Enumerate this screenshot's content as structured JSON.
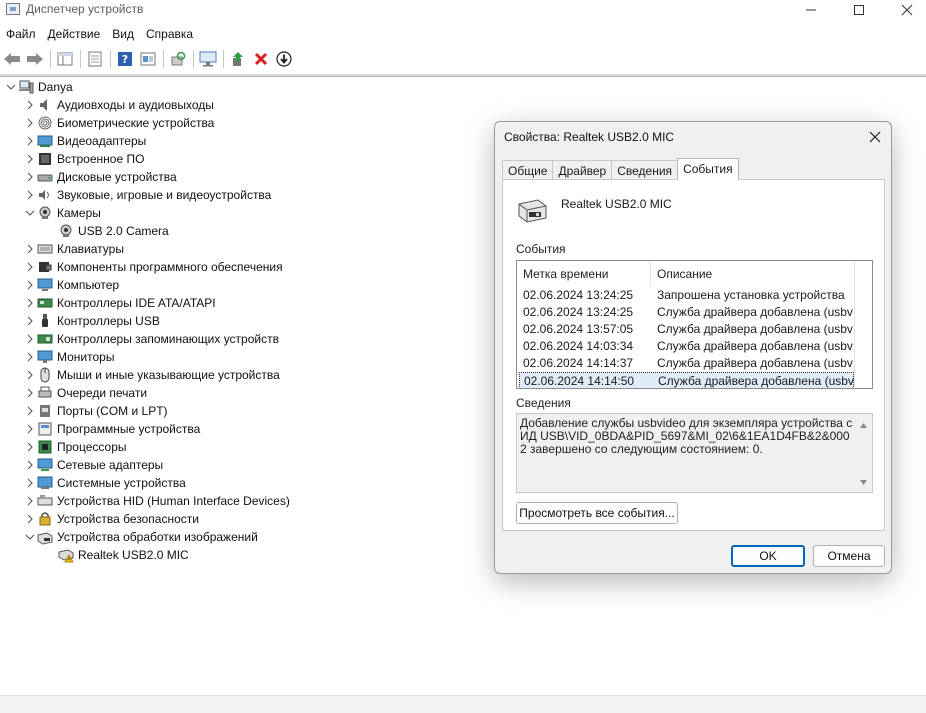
{
  "window": {
    "title": "Диспетчер устройств"
  },
  "menu": [
    "Файл",
    "Действие",
    "Вид",
    "Справка"
  ],
  "toolbar": {
    "buttons": [
      "back-arrow-icon",
      "forward-arrow-icon",
      "console-tree-icon",
      "properties-icon",
      "help-icon",
      "view-icon",
      "scan-hardware-icon",
      "monitor-icon",
      "update-driver-icon",
      "uninstall-icon",
      "disable-icon"
    ],
    "colors": {
      "green": "#2e9e3e",
      "red": "#d81e1e",
      "blue": "#2b6cc4"
    }
  },
  "tree": {
    "root": "Danya",
    "items": [
      {
        "label": "Аудиовходы и аудиовыходы",
        "icon": "speaker-icon",
        "expanded": false
      },
      {
        "label": "Биометрические устройства",
        "icon": "fingerprint-icon",
        "expanded": false
      },
      {
        "label": "Видеоадаптеры",
        "icon": "display-adapter-icon",
        "expanded": false
      },
      {
        "label": "Встроенное ПО",
        "icon": "firmware-icon",
        "expanded": false
      },
      {
        "label": "Дисковые устройства",
        "icon": "disk-drive-icon",
        "expanded": false
      },
      {
        "label": "Звуковые, игровые и видеоустройства",
        "icon": "sound-icon",
        "expanded": false
      },
      {
        "label": "Камеры",
        "icon": "camera-icon",
        "expanded": true,
        "children": [
          {
            "label": "USB 2.0 Camera",
            "icon": "camera-icon"
          }
        ]
      },
      {
        "label": "Клавиатуры",
        "icon": "keyboard-icon",
        "expanded": false
      },
      {
        "label": "Компоненты программного обеспечения",
        "icon": "software-component-icon",
        "expanded": false
      },
      {
        "label": "Компьютер",
        "icon": "computer-icon",
        "expanded": false
      },
      {
        "label": "Контроллеры IDE ATA/ATAPI",
        "icon": "ide-controller-icon",
        "expanded": false
      },
      {
        "label": "Контроллеры USB",
        "icon": "usb-icon",
        "expanded": false
      },
      {
        "label": "Контроллеры запоминающих устройств",
        "icon": "storage-controller-icon",
        "expanded": false
      },
      {
        "label": "Мониторы",
        "icon": "monitor-icon",
        "expanded": false
      },
      {
        "label": "Мыши и иные указывающие устройства",
        "icon": "mouse-icon",
        "expanded": false
      },
      {
        "label": "Очереди печати",
        "icon": "printer-icon",
        "expanded": false
      },
      {
        "label": "Порты (COM и LPT)",
        "icon": "port-icon",
        "expanded": false
      },
      {
        "label": "Программные устройства",
        "icon": "software-device-icon",
        "expanded": false
      },
      {
        "label": "Процессоры",
        "icon": "processor-icon",
        "expanded": false
      },
      {
        "label": "Сетевые адаптеры",
        "icon": "network-adapter-icon",
        "expanded": false
      },
      {
        "label": "Системные устройства",
        "icon": "system-device-icon",
        "expanded": false
      },
      {
        "label": "Устройства HID (Human Interface Devices)",
        "icon": "hid-icon",
        "expanded": false
      },
      {
        "label": "Устройства безопасности",
        "icon": "security-device-icon",
        "expanded": false
      },
      {
        "label": "Устройства обработки изображений",
        "icon": "imaging-device-icon",
        "expanded": true,
        "children": [
          {
            "label": "Realtek USB2.0 MIC",
            "icon": "imaging-warning-icon"
          }
        ]
      }
    ]
  },
  "dialog": {
    "title": "Свойства: Realtek USB2.0 MIC",
    "tabs": [
      "Общие",
      "Драйвер",
      "Сведения",
      "События"
    ],
    "active_tab": "События",
    "device_name": "Realtek USB2.0 MIC",
    "events_label": "События",
    "columns": [
      "Метка времени",
      "Описание"
    ],
    "events": [
      {
        "time": "02.06.2024 13:24:25",
        "desc": "Запрошена установка устройства"
      },
      {
        "time": "02.06.2024 13:24:25",
        "desc": "Служба драйвера добавлена (usbvi..."
      },
      {
        "time": "02.06.2024 13:57:05",
        "desc": "Служба драйвера добавлена (usbvi..."
      },
      {
        "time": "02.06.2024 14:03:34",
        "desc": "Служба драйвера добавлена (usbvi..."
      },
      {
        "time": "02.06.2024 14:14:37",
        "desc": "Служба драйвера добавлена (usbvi..."
      },
      {
        "time": "02.06.2024 14:14:50",
        "desc": "Служба драйвера добавлена (usbvi..."
      }
    ],
    "selected_event": 5,
    "details_label": "Сведения",
    "details_text": "Добавление службы usbvideo для экземпляра устройства с ИД USB\\VID_0BDA&PID_5697&MI_02\\6&1EA1D4FB&2&0002 завершено со следующим состоянием: 0.",
    "view_all_button": "Просмотреть все события...",
    "ok_button": "OK",
    "cancel_button": "Отмена"
  }
}
